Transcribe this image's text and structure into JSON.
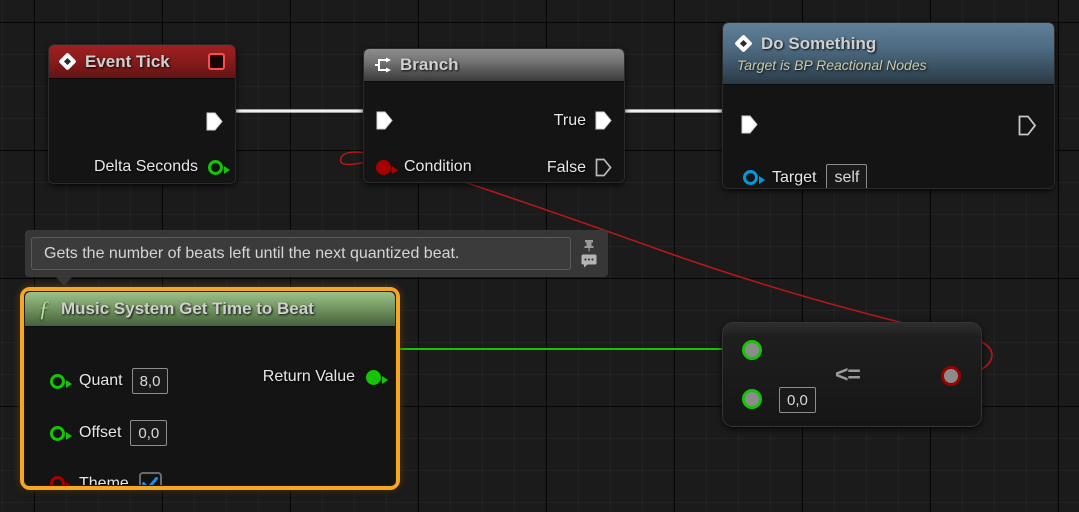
{
  "graph": {
    "background_color": "#1b1b1b",
    "grid_minor_color": "#232323",
    "grid_major_color": "#000000"
  },
  "nodes": {
    "event_tick": {
      "title": "Event Tick",
      "icon": "event-diamond-icon",
      "badge_icon": "delegate-square-icon",
      "header_color": "#8a1c1c",
      "exec_out_label": "",
      "outputs": [
        {
          "label": "Delta Seconds",
          "pin_type": "float",
          "pin_color": "#16c406"
        }
      ]
    },
    "branch": {
      "title": "Branch",
      "icon": "branch-icon",
      "header_color": "#757575",
      "inputs": [
        {
          "label": "Condition",
          "pin_type": "bool",
          "pin_color": "#a80000"
        }
      ],
      "outputs": [
        {
          "label": "True",
          "pin_type": "exec"
        },
        {
          "label": "False",
          "pin_type": "exec"
        }
      ]
    },
    "do_something": {
      "title": "Do Something",
      "subtitle": "Target is BP Reactional Nodes",
      "icon": "event-diamond-icon",
      "header_color": "#4e6c83",
      "inputs": [
        {
          "label": "Target",
          "value": "self",
          "pin_type": "object",
          "pin_color": "#0099dd"
        }
      ]
    },
    "music_system": {
      "title": "Music System Get Time to Beat",
      "icon": "function-f-icon",
      "header_color": "#7ea26b",
      "selected": true,
      "selection_color": "#f5a623",
      "inputs": [
        {
          "label": "Quant",
          "value": "8,0",
          "pin_type": "float",
          "pin_color": "#16c406",
          "widget": "textbox"
        },
        {
          "label": "Offset",
          "value": "0,0",
          "pin_type": "float",
          "pin_color": "#16c406",
          "widget": "textbox"
        },
        {
          "label": "Theme",
          "value": "true",
          "pin_type": "bool",
          "pin_color": "#a80000",
          "widget": "checkbox"
        }
      ],
      "outputs": [
        {
          "label": "Return Value",
          "pin_type": "float",
          "pin_color": "#16c406"
        }
      ]
    },
    "compare": {
      "operator": "<=",
      "inputs": [
        {
          "label": "",
          "value": "",
          "pin_color": "#16c406"
        },
        {
          "label": "",
          "value": "0,0",
          "pin_color": "#16c406"
        }
      ],
      "outputs": [
        {
          "label": "",
          "pin_color": "#9b0000"
        }
      ]
    }
  },
  "tooltip": {
    "text": "Gets the number of beats left until the next quantized beat.",
    "pin_icon": "pushpin-icon",
    "comment_icon": "comment-bubble-icon"
  },
  "wires": [
    {
      "name": "exec-tick-to-branch",
      "type": "exec",
      "color": "#ffffff"
    },
    {
      "name": "exec-true-to-do",
      "type": "exec",
      "color": "#ffffff"
    },
    {
      "name": "data-return-to-compare",
      "type": "float",
      "color": "#16c406"
    },
    {
      "name": "data-compare-to-condition",
      "type": "bool",
      "color": "#b41818"
    }
  ]
}
